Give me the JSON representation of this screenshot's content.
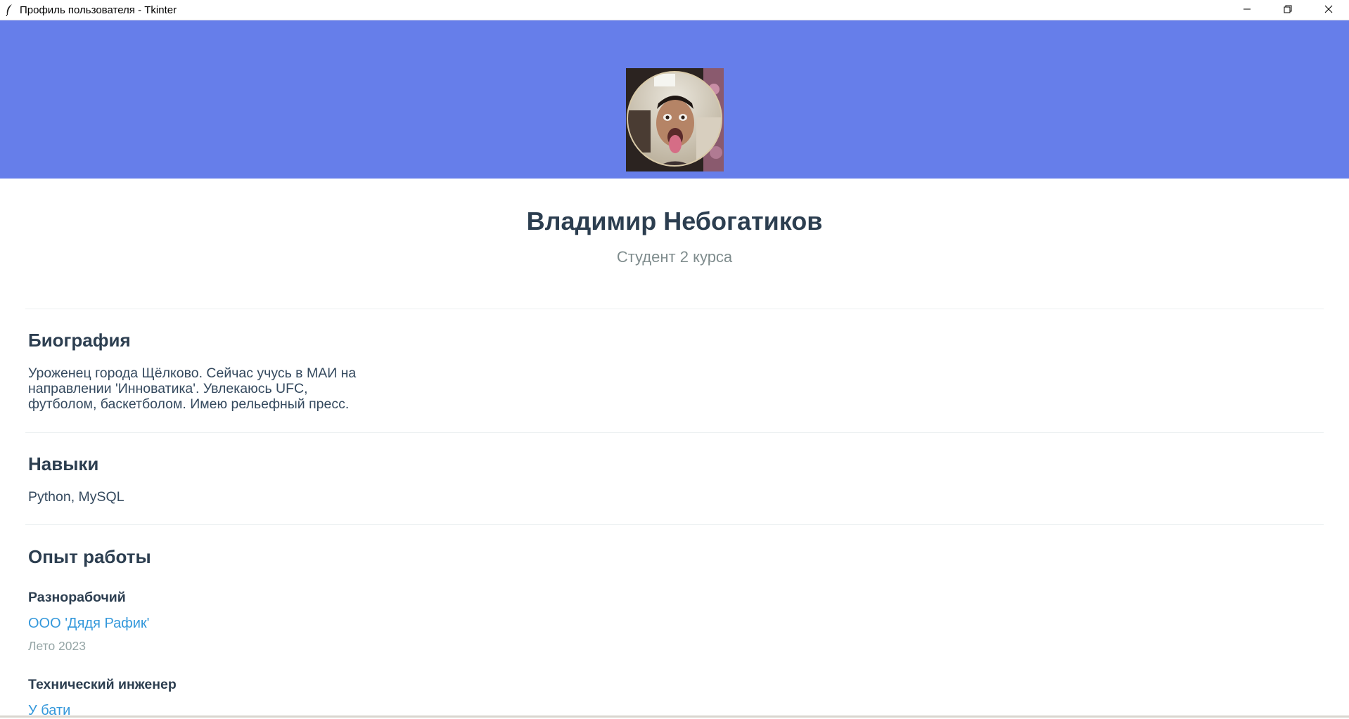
{
  "window": {
    "title": "Профиль пользователя - Tkinter",
    "icon": "feather-icon",
    "controls": [
      "minimize-icon",
      "restore-icon",
      "close-icon"
    ]
  },
  "colors": {
    "header_band": "#667eea",
    "name": "#2c3e50",
    "subtitle": "#7f8c8d",
    "section_title": "#2c3e50",
    "body_text": "#34495e",
    "company_link": "#3498db",
    "period": "#95a5a6"
  },
  "profile": {
    "name": "Владимир Небогатиков",
    "subtitle": "Студент 2 курса"
  },
  "biography": {
    "title": "Биография",
    "lines": [
      "Уроженец города Щёлково. Сейчас учусь в МАИ на",
      "направлении 'Инноватика'. Увлекаюсь UFC,",
      "футболом, баскетболом. Имею рельефный пресс."
    ]
  },
  "skills": {
    "title": "Навыки",
    "text": "Python, MySQL"
  },
  "experience": {
    "title": "Опыт работы",
    "jobs": [
      {
        "position": "Разнорабочий",
        "company": "ООО 'Дядя Рафик'",
        "period": "Лето 2023"
      },
      {
        "position": "Технический инженер",
        "company": "У бати"
      }
    ]
  }
}
